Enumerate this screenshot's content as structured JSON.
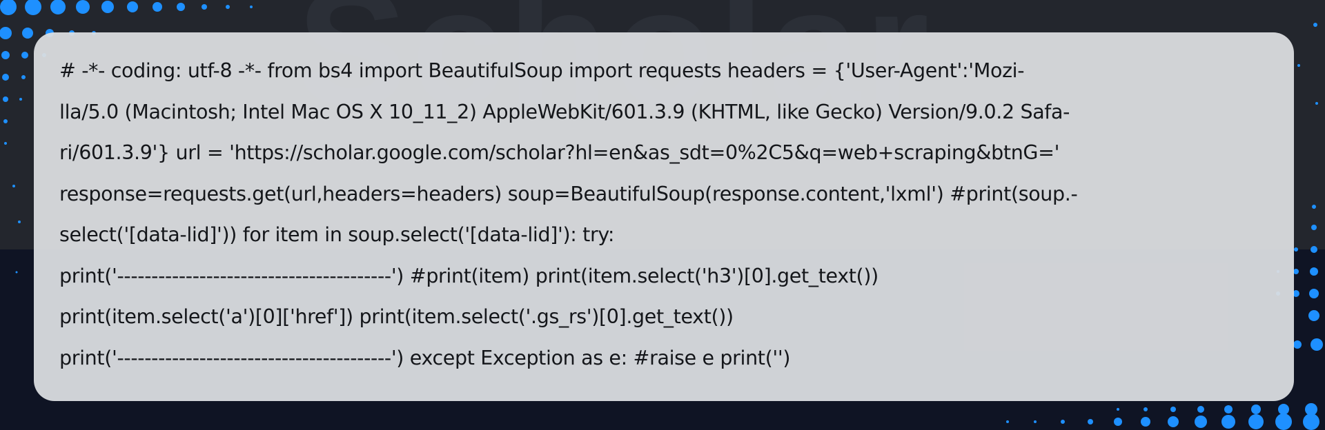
{
  "background": {
    "watermark_text": "Scholar",
    "colors": {
      "top_band": "#23262d",
      "bottom_band": "#0f1424",
      "dots": "#1e90ff",
      "card": "#dcdee1",
      "code_text": "#14161a"
    }
  },
  "code_block": {
    "lines": [
      "# -*- coding: utf-8 -*- from bs4 import BeautifulSoup import requests headers = {'User-Agent':'Mozi-",
      "lla/5.0 (Macintosh; Intel Mac OS X 10_11_2) AppleWebKit/601.3.9 (KHTML, like Gecko) Version/9.0.2 Safa-",
      "ri/601.3.9'} url = 'https://scholar.google.com/scholar?hl=en&as_sdt=0%2C5&q=web+scraping&btnG='",
      "response=requests.get(url,headers=headers) soup=BeautifulSoup(response.content,'lxml') #print(soup.-",
      "select('[data-lid]')) for item in soup.select('[data-lid]'): try:",
      "print('----------------------------------------') #print(item) print(item.select('h3')[0].get_text())",
      "print(item.select('a')[0]['href']) print(item.select('.gs_rs')[0].get_text())",
      "print('----------------------------------------') except Exception as e: #raise e print('')"
    ]
  }
}
